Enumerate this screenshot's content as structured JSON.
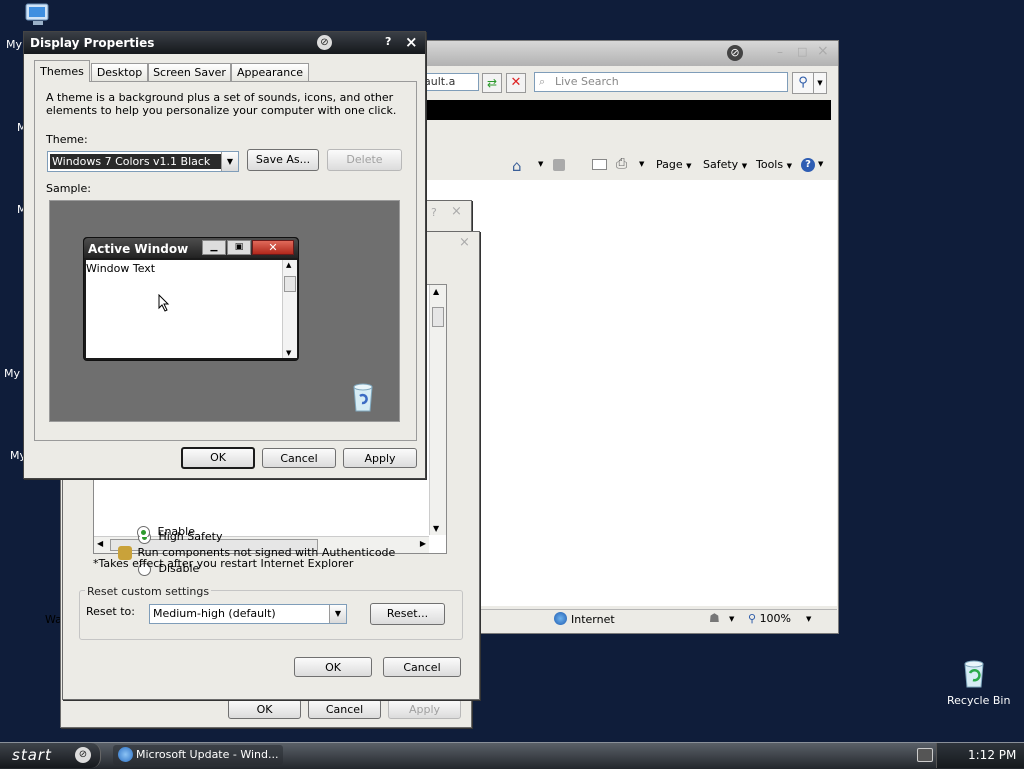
{
  "desktop": {
    "labels": [
      "My",
      "M",
      "M",
      "My I",
      "My"
    ],
    "recycle_bin_label": "Recycle Bin"
  },
  "ie": {
    "address_tail": "ault.a",
    "search_placeholder": "Live Search",
    "toolbar": {
      "page": "Page",
      "safety": "Safety",
      "tools": "Tools"
    },
    "status": {
      "left": "Wa",
      "zone": "Internet",
      "zoom": "100%"
    }
  },
  "security_dialog": {
    "items": [
      {
        "type": "radio",
        "checked": true,
        "label": "High Safety"
      },
      {
        "type": "header",
        "label": "Run components not signed with Authenticode"
      },
      {
        "type": "radio",
        "checked": false,
        "label": "Disable"
      },
      {
        "type": "radio",
        "checked": true,
        "label": "Enable"
      }
    ],
    "footnote": "*Takes effect after you restart Internet Explorer",
    "reset_group_label": "Reset custom settings",
    "reset_to_label": "Reset to:",
    "reset_to_value": "Medium-high (default)",
    "reset_button": "Reset...",
    "ok": "OK",
    "cancel": "Cancel"
  },
  "internet_options": {
    "ok": "OK",
    "cancel": "Cancel",
    "apply": "Apply"
  },
  "display_properties": {
    "title": "Display Properties",
    "help": "?",
    "close": "×",
    "tabs": [
      "Themes",
      "Desktop",
      "Screen Saver",
      "Appearance"
    ],
    "description": "A theme is a background plus a set of sounds, icons, and other elements to help you personalize your computer with one click.",
    "theme_label": "Theme:",
    "theme_value": "Windows 7 Colors v1.1 Black",
    "save_as": "Save As...",
    "delete": "Delete",
    "sample_label": "Sample:",
    "sample_window_title": "Active Window",
    "sample_window_text": "Window Text",
    "ok": "OK",
    "cancel": "Cancel",
    "apply": "Apply"
  },
  "taskbar": {
    "start_label": "start",
    "task_label": "Microsoft Update - Wind...",
    "clock": "1:12 PM"
  }
}
